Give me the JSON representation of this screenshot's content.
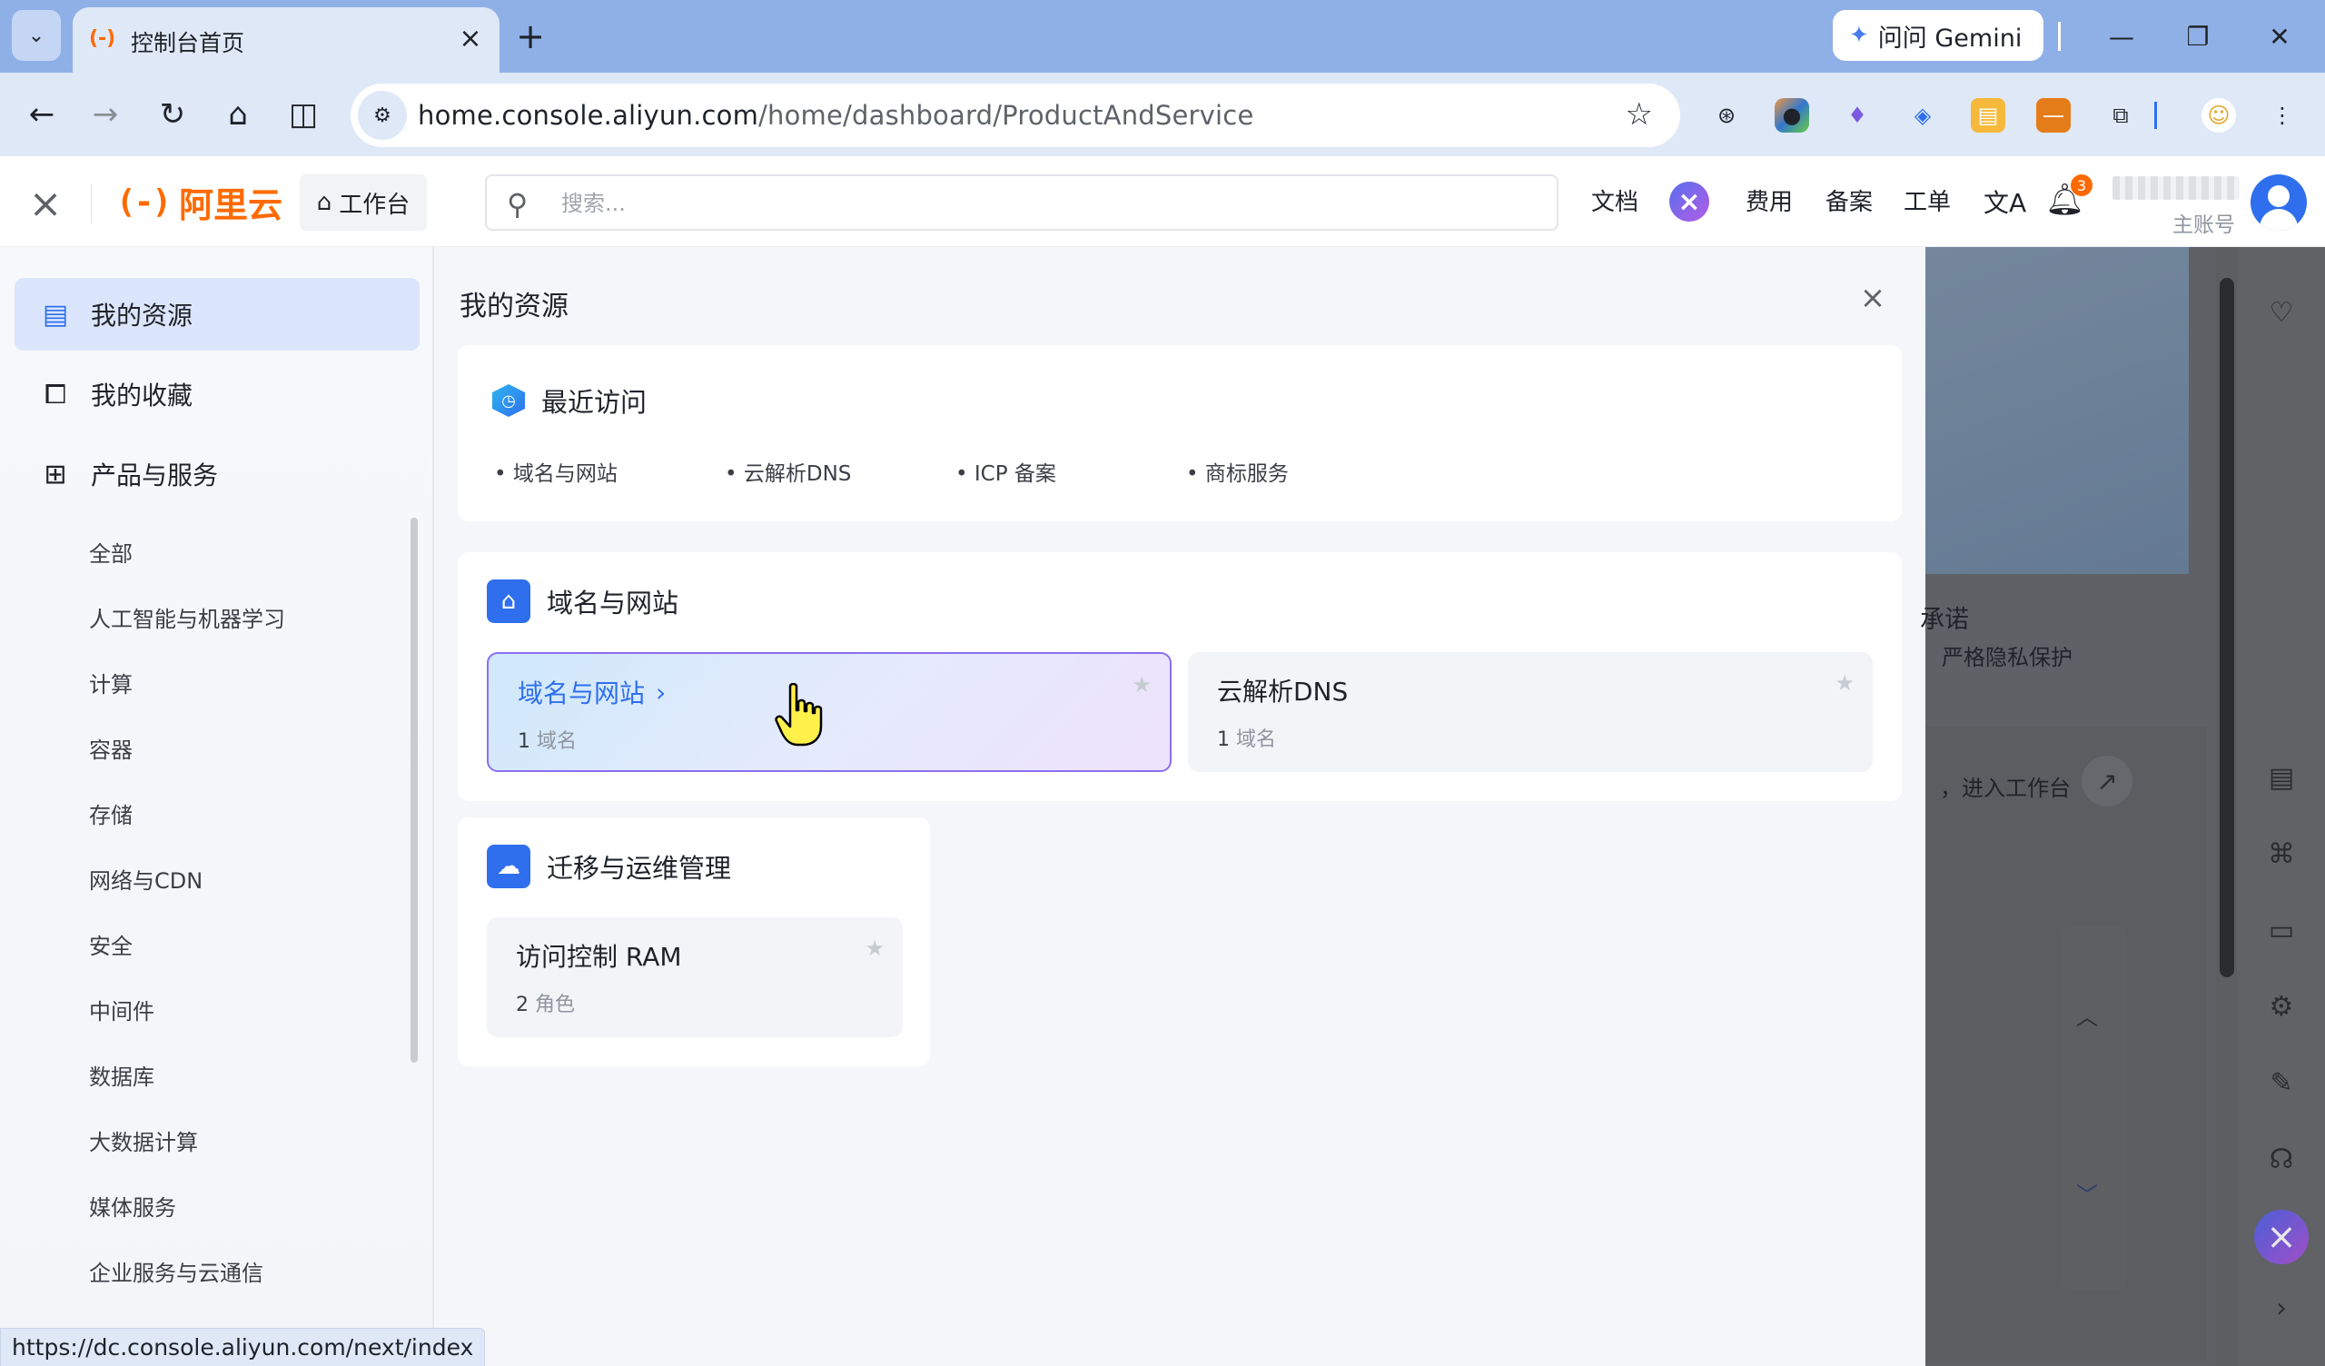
{
  "browser": {
    "tab_title": "控制台首页",
    "gemini_label": "问问 Gemini",
    "url_host": "home.console.aliyun.com",
    "url_path": "/home/dashboard/ProductAndService",
    "status_url": "https://dc.console.aliyun.com/next/index"
  },
  "header": {
    "logo_text": "阿里云",
    "logo_mark": "(-)",
    "workbench_label": "工作台",
    "search_placeholder": "搜索...",
    "docs_label": "文档",
    "billing_label": "费用",
    "icp_label": "备案",
    "ticket_label": "工单",
    "notification_count": "3",
    "account_type": "主账号",
    "brand_color": "#ff6a00",
    "accent_color": "#2f6fed"
  },
  "sidebar": {
    "nav": [
      {
        "label": "我的资源",
        "icon": "resource-icon",
        "active": true
      },
      {
        "label": "我的收藏",
        "icon": "favorites-icon",
        "active": false
      },
      {
        "label": "产品与服务",
        "icon": "grid-icon",
        "active": false
      }
    ],
    "categories": [
      "全部",
      "人工智能与机器学习",
      "计算",
      "容器",
      "存储",
      "网络与CDN",
      "安全",
      "中间件",
      "数据库",
      "大数据计算",
      "媒体服务",
      "企业服务与云通信"
    ]
  },
  "panel": {
    "title": "我的资源",
    "recent": {
      "title": "最近访问",
      "items": [
        "域名与网站",
        "云解析DNS",
        "ICP 备案",
        "商标服务"
      ]
    },
    "groups": [
      {
        "title": "域名与网站",
        "services": [
          {
            "name": "域名与网站",
            "count": "1",
            "unit": "域名"
          },
          {
            "name": "云解析DNS",
            "count": "1",
            "unit": "域名"
          }
        ]
      },
      {
        "title": "迁移与运维管理",
        "services": [
          {
            "name": "访问控制 RAM",
            "count": "2",
            "unit": "角色"
          }
        ]
      }
    ]
  },
  "background": {
    "promise_text": "承诺",
    "privacy_text": "严格隐私保护",
    "enter_workbench_text": "，进入工作台"
  }
}
